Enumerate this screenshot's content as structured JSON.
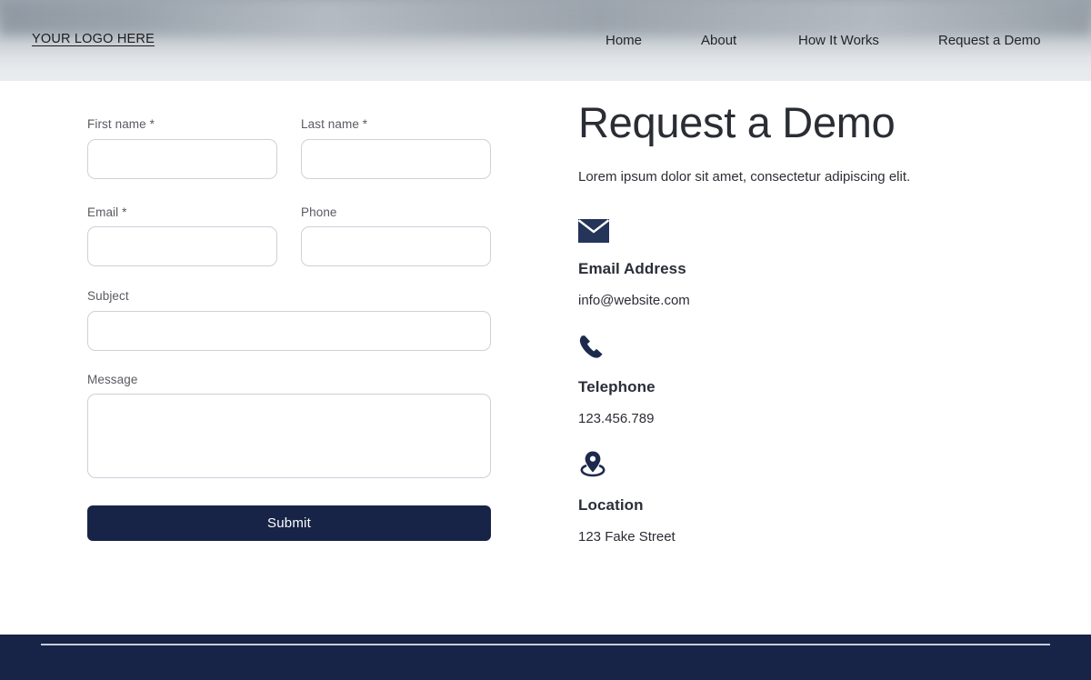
{
  "header": {
    "logo": "YOUR LOGO HERE",
    "nav": [
      {
        "label": "Home"
      },
      {
        "label": "About"
      },
      {
        "label": "How It Works"
      },
      {
        "label": "Request a Demo"
      }
    ]
  },
  "form": {
    "fields": {
      "first_name": {
        "label": "First name *",
        "value": "",
        "placeholder": ""
      },
      "last_name": {
        "label": "Last name *",
        "value": "",
        "placeholder": ""
      },
      "email": {
        "label": "Email *",
        "value": "",
        "placeholder": ""
      },
      "phone": {
        "label": "Phone",
        "value": "",
        "placeholder": ""
      },
      "subject": {
        "label": "Subject",
        "value": "",
        "placeholder": ""
      },
      "message": {
        "label": "Message",
        "value": "",
        "placeholder": ""
      }
    },
    "submit_label": "Submit"
  },
  "main": {
    "title": "Request a Demo",
    "subtitle": "Lorem ipsum dolor sit amet, consectetur adipiscing elit.",
    "contacts": [
      {
        "icon": "envelope-icon",
        "heading": "Email Address",
        "value": "info@website.com"
      },
      {
        "icon": "phone-icon",
        "heading": "Telephone",
        "value": "123.456.789"
      },
      {
        "icon": "map-pin-icon",
        "heading": "Location",
        "value": "123 Fake Street"
      }
    ]
  },
  "colors": {
    "navy": "#172448",
    "header_bottom": "#e8ebee",
    "input_border": "#cfd0d9",
    "label_gray": "#5a5a62",
    "footer_rule": "#c9cdda"
  }
}
